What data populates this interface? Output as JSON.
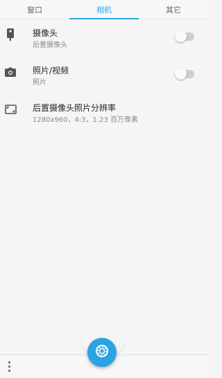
{
  "tabs": [
    {
      "label": "窗口",
      "active": false
    },
    {
      "label": "相机",
      "active": true
    },
    {
      "label": "其它",
      "active": false
    }
  ],
  "settings": [
    {
      "icon": "phone-camera-icon",
      "title": "摄像头",
      "subtitle": "后置摄像头",
      "toggle": false
    },
    {
      "icon": "camera-icon",
      "title": "照片/视频",
      "subtitle": "照片",
      "toggle": false
    },
    {
      "icon": "aspect-ratio-icon",
      "title": "后置摄像头照片分辨率",
      "subtitle": "1280x960，4:3，1.23 百万像素"
    }
  ],
  "colors": {
    "accent": "#29a6e6",
    "background": "#f5f5f5",
    "switch_off_track": "#cfcfcf"
  },
  "bottom": {
    "fab_icon": "shutter-icon",
    "menu_icon": "more-vert-icon"
  }
}
